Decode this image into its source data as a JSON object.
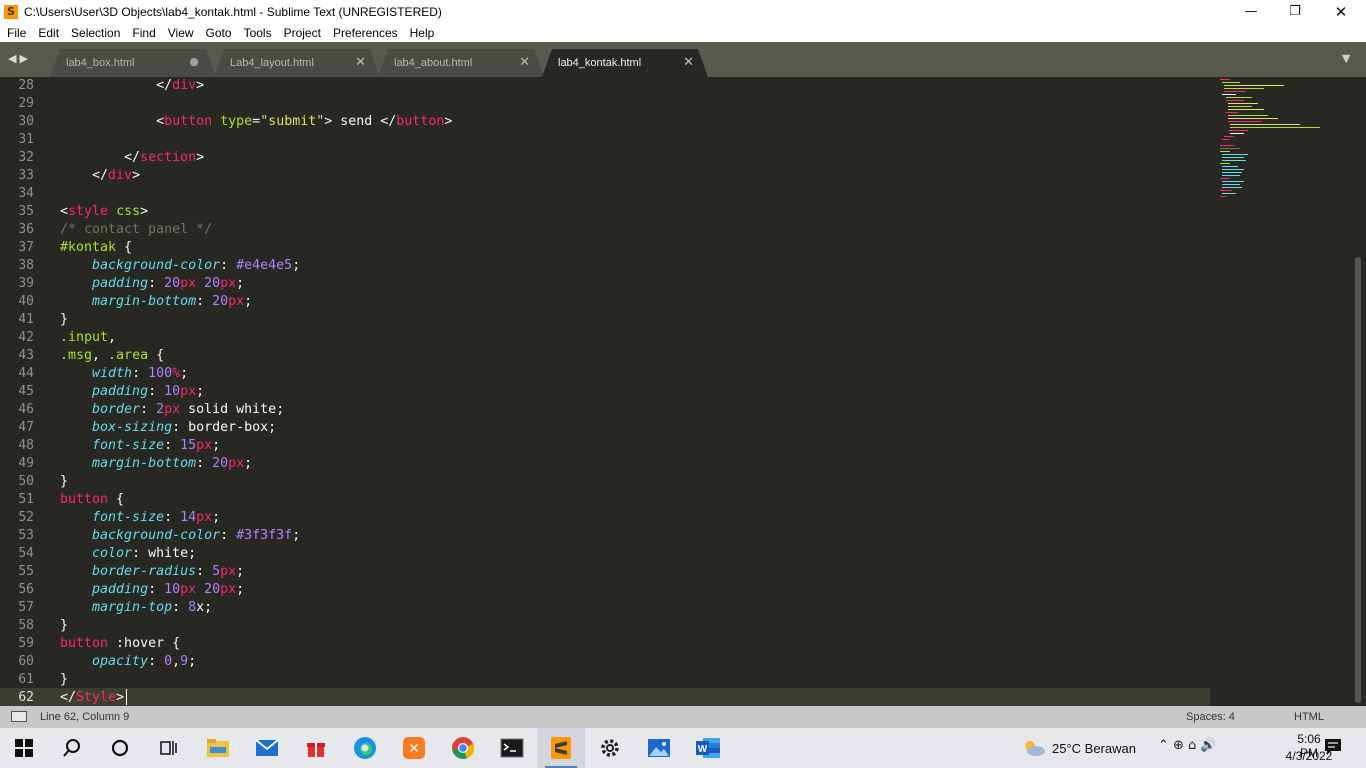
{
  "window": {
    "icon_glyph": "S",
    "title": "C:\\Users\\User\\3D Objects\\lab4_kontak.html - Sublime Text (UNREGISTERED)",
    "minimize": "—",
    "maximize": "❐",
    "close": "✕"
  },
  "menu": [
    "File",
    "Edit",
    "Selection",
    "Find",
    "View",
    "Goto",
    "Tools",
    "Project",
    "Preferences",
    "Help"
  ],
  "tabs": {
    "nav": "◀▶",
    "dropdown": "▼",
    "items": [
      {
        "label": "lab4_box.html",
        "state": "dirty",
        "marker": "●"
      },
      {
        "label": "Lab4_layout.html",
        "state": "clean",
        "marker": "✕"
      },
      {
        "label": "lab4_about.html",
        "state": "clean",
        "marker": "✕"
      },
      {
        "label": "lab4_kontak.html",
        "state": "active",
        "marker": "✕"
      }
    ]
  },
  "editor": {
    "line_numbers": [
      "28",
      "29",
      "30",
      "31",
      "32",
      "33",
      "34",
      "35",
      "36",
      "37",
      "38",
      "39",
      "40",
      "41",
      "42",
      "43",
      "44",
      "45",
      "46",
      "47",
      "48",
      "49",
      "50",
      "51",
      "52",
      "53",
      "54",
      "55",
      "56",
      "57",
      "58",
      "59",
      "60",
      "61",
      "62"
    ],
    "current_line": "62",
    "lines": [
      [
        [
          "w",
          "            </"
        ],
        [
          "t",
          "div"
        ],
        [
          "w",
          ">"
        ]
      ],
      [],
      [
        [
          "w",
          "            <"
        ],
        [
          "t",
          "button"
        ],
        [
          "w",
          " "
        ],
        [
          "a",
          "type"
        ],
        [
          "w",
          "="
        ],
        [
          "s",
          "\"submit\""
        ],
        [
          "w",
          "> send </"
        ],
        [
          "t",
          "button"
        ],
        [
          "w",
          ">"
        ]
      ],
      [],
      [
        [
          "w",
          "        </"
        ],
        [
          "t",
          "section"
        ],
        [
          "w",
          ">"
        ]
      ],
      [
        [
          "w",
          "    </"
        ],
        [
          "t",
          "div"
        ],
        [
          "w",
          ">"
        ]
      ],
      [],
      [
        [
          "w",
          "<"
        ],
        [
          "t",
          "style"
        ],
        [
          "w",
          " "
        ],
        [
          "a",
          "css"
        ],
        [
          "w",
          ">"
        ]
      ],
      [
        [
          "c",
          "/* contact panel */"
        ]
      ],
      [
        [
          "a",
          "#kontak"
        ],
        [
          "w",
          " {"
        ]
      ],
      [
        [
          "w",
          "    "
        ],
        [
          "p",
          "background-color"
        ],
        [
          "w",
          ": "
        ],
        [
          "n",
          "#e4e4e5"
        ],
        [
          "w",
          ";"
        ]
      ],
      [
        [
          "w",
          "    "
        ],
        [
          "p",
          "padding"
        ],
        [
          "w",
          ": "
        ],
        [
          "n",
          "20"
        ],
        [
          "u",
          "px"
        ],
        [
          "w",
          " "
        ],
        [
          "n",
          "20"
        ],
        [
          "u",
          "px"
        ],
        [
          "w",
          ";"
        ]
      ],
      [
        [
          "w",
          "    "
        ],
        [
          "p",
          "margin-bottom"
        ],
        [
          "w",
          ": "
        ],
        [
          "n",
          "20"
        ],
        [
          "u",
          "px"
        ],
        [
          "w",
          ";"
        ]
      ],
      [
        [
          "w",
          "}"
        ]
      ],
      [
        [
          "a",
          ".input"
        ],
        [
          "w",
          ","
        ]
      ],
      [
        [
          "a",
          ".msg"
        ],
        [
          "w",
          ", "
        ],
        [
          "a",
          ".area"
        ],
        [
          "w",
          " {"
        ]
      ],
      [
        [
          "w",
          "    "
        ],
        [
          "p",
          "width"
        ],
        [
          "w",
          ": "
        ],
        [
          "n",
          "100"
        ],
        [
          "u",
          "%"
        ],
        [
          "w",
          ";"
        ]
      ],
      [
        [
          "w",
          "    "
        ],
        [
          "p",
          "padding"
        ],
        [
          "w",
          ": "
        ],
        [
          "n",
          "10"
        ],
        [
          "u",
          "px"
        ],
        [
          "w",
          ";"
        ]
      ],
      [
        [
          "w",
          "    "
        ],
        [
          "p",
          "border"
        ],
        [
          "w",
          ": "
        ],
        [
          "n",
          "2"
        ],
        [
          "u",
          "px"
        ],
        [
          "w",
          " solid white;"
        ]
      ],
      [
        [
          "w",
          "    "
        ],
        [
          "p",
          "box-sizing"
        ],
        [
          "w",
          ": border-box;"
        ]
      ],
      [
        [
          "w",
          "    "
        ],
        [
          "p",
          "font-size"
        ],
        [
          "w",
          ": "
        ],
        [
          "n",
          "15"
        ],
        [
          "u",
          "px"
        ],
        [
          "w",
          ";"
        ]
      ],
      [
        [
          "w",
          "    "
        ],
        [
          "p",
          "margin-bottom"
        ],
        [
          "w",
          ": "
        ],
        [
          "n",
          "20"
        ],
        [
          "u",
          "px"
        ],
        [
          "w",
          ";"
        ]
      ],
      [
        [
          "w",
          "}"
        ]
      ],
      [
        [
          "t",
          "button"
        ],
        [
          "w",
          " {"
        ]
      ],
      [
        [
          "w",
          "    "
        ],
        [
          "p",
          "font-size"
        ],
        [
          "w",
          ": "
        ],
        [
          "n",
          "14"
        ],
        [
          "u",
          "px"
        ],
        [
          "w",
          ";"
        ]
      ],
      [
        [
          "w",
          "    "
        ],
        [
          "p",
          "background-color"
        ],
        [
          "w",
          ": "
        ],
        [
          "n",
          "#3f3f3f"
        ],
        [
          "w",
          ";"
        ]
      ],
      [
        [
          "w",
          "    "
        ],
        [
          "p",
          "color"
        ],
        [
          "w",
          ": white;"
        ]
      ],
      [
        [
          "w",
          "    "
        ],
        [
          "p",
          "border-radius"
        ],
        [
          "w",
          ": "
        ],
        [
          "n",
          "5"
        ],
        [
          "u",
          "px"
        ],
        [
          "w",
          ";"
        ]
      ],
      [
        [
          "w",
          "    "
        ],
        [
          "p",
          "padding"
        ],
        [
          "w",
          ": "
        ],
        [
          "n",
          "10"
        ],
        [
          "u",
          "px"
        ],
        [
          "w",
          " "
        ],
        [
          "n",
          "20"
        ],
        [
          "u",
          "px"
        ],
        [
          "w",
          ";"
        ]
      ],
      [
        [
          "w",
          "    "
        ],
        [
          "p",
          "margin-top"
        ],
        [
          "w",
          ": "
        ],
        [
          "n",
          "8"
        ],
        [
          "w",
          "x;"
        ]
      ],
      [
        [
          "w",
          "}"
        ]
      ],
      [
        [
          "t",
          "button"
        ],
        [
          "w",
          " :hover {"
        ]
      ],
      [
        [
          "w",
          "    "
        ],
        [
          "p",
          "opacity"
        ],
        [
          "w",
          ": "
        ],
        [
          "n",
          "0"
        ],
        [
          "w",
          ","
        ],
        [
          "n",
          "9"
        ],
        [
          "w",
          ";"
        ]
      ],
      [
        [
          "w",
          "}"
        ]
      ],
      [
        [
          "w",
          "</"
        ],
        [
          "t",
          "Style"
        ],
        [
          "w",
          ">"
        ]
      ]
    ]
  },
  "status": {
    "position": "Line 62, Column 9",
    "spaces": "Spaces: 4",
    "syntax": "HTML"
  },
  "taskbar": {
    "apps": [
      "start-icon",
      "search-icon",
      "cortana-icon",
      "task-view-icon",
      "file-explorer-icon",
      "mail-icon",
      "gift-icon",
      "edge-icon",
      "xampp-icon",
      "chrome-icon",
      "terminal-icon",
      "sublime-text-icon",
      "settings-icon",
      "photos-icon",
      "word-icon"
    ],
    "active_app": "sublime-text-icon",
    "weather": "25°C  Berawan",
    "tray": "⌃  ⊕  ⌂  🔊",
    "time": "5:06 PM",
    "date": "4/3/2022"
  },
  "colors": {
    "editor_bg": "#272822",
    "tag": "#f92672",
    "attribute": "#a6e22e",
    "string": "#e6db74",
    "property": "#66d9ef",
    "number": "#ae81ff",
    "comment": "#75715e",
    "text": "#f8f8f2"
  }
}
